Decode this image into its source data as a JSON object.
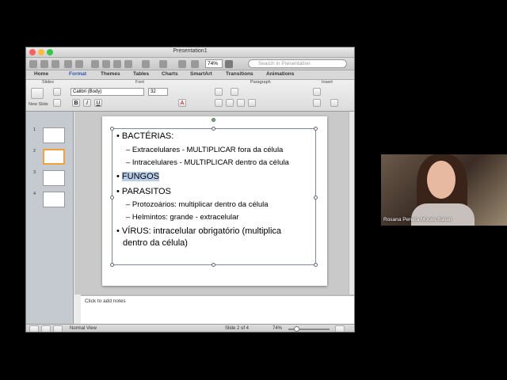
{
  "window": {
    "title": "Presentation1",
    "zoom": "74%",
    "search_placeholder": "Search in Presentation"
  },
  "ribbon": {
    "tabs": [
      "Home",
      "Format",
      "Themes",
      "Tables",
      "Charts",
      "SmartArt",
      "Transitions",
      "Animations"
    ],
    "active_tab": "Format",
    "groups": {
      "slides": "Slides",
      "font": "Font",
      "paragraph": "Paragraph",
      "insert": "Insert"
    },
    "new_slide_label": "New Slide",
    "font_name": "Calibri (Body)",
    "font_size": "32"
  },
  "sidebar": {
    "slide_numbers": [
      "1",
      "2",
      "3",
      "4"
    ],
    "selected": "2"
  },
  "slide": {
    "lines": [
      {
        "level": 1,
        "text": "BACTÉRIAS:"
      },
      {
        "level": 2,
        "text": "– Extracelulares - MULTIPLICAR fora da célula"
      },
      {
        "level": 2,
        "text": "– Intracelulares - MULTIPLICAR dentro da célula"
      },
      {
        "level": 1,
        "text": "FUNGOS"
      },
      {
        "level": 1,
        "text": "PARASITOS"
      },
      {
        "level": 2,
        "text": "– Protozoários: multiplicar dentro da célula"
      },
      {
        "level": 2,
        "text": "– Helmintos: grande - extracelular"
      },
      {
        "level": 1,
        "text": "VÍRUS: intracelular obrigatório (multiplica"
      },
      {
        "level": 1,
        "text": "dentro da célula)"
      }
    ]
  },
  "notes": {
    "placeholder": "Click to add notes"
  },
  "status": {
    "view": "Normal View",
    "slide_info": "Slide 2 of 4",
    "zoom": "74%"
  },
  "video": {
    "participant": "Rosana Pereira Morais Balian"
  }
}
